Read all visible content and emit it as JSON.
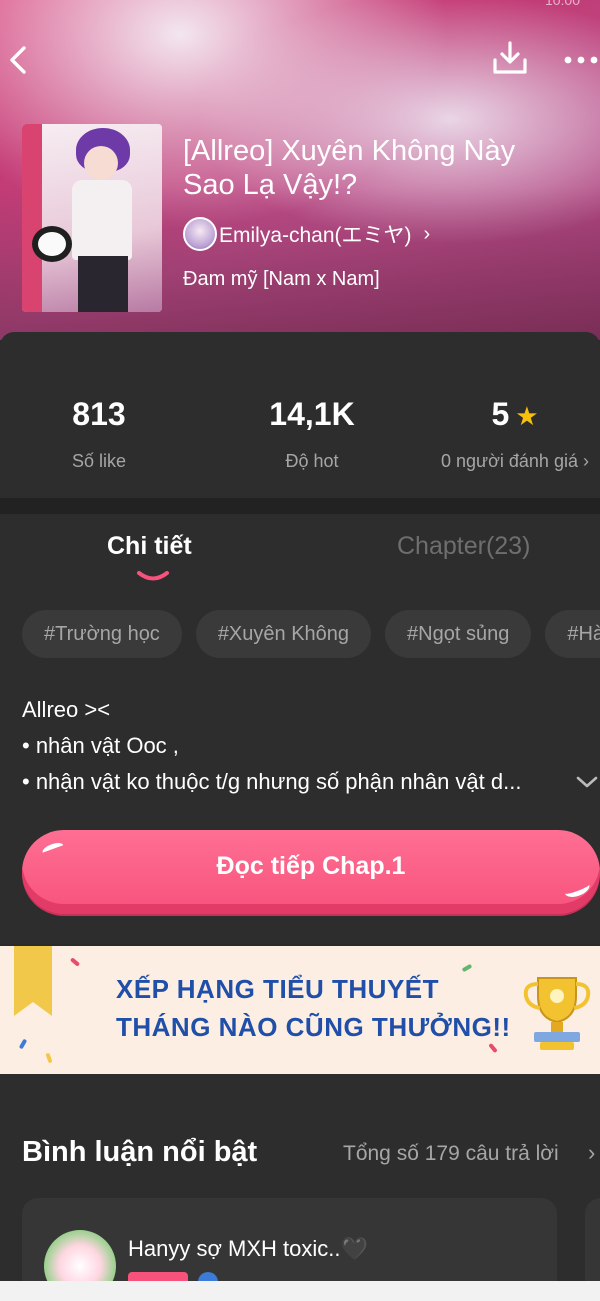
{
  "status": {
    "time": "10:00"
  },
  "header": {
    "title": "[Allreo] Xuyên Không Này Sao Lạ Vậy!?",
    "author": "Emilya-chan(エミヤ)",
    "genre": "Đam mỹ [Nam x Nam]",
    "icons": [
      "back-icon",
      "download-icon",
      "more-icon"
    ]
  },
  "stats": [
    {
      "value": "813",
      "label": "Số like"
    },
    {
      "value": "14,1K",
      "label": "Độ hot"
    },
    {
      "value": "5",
      "label": "0 người đánh giá ›"
    }
  ],
  "tabs": [
    {
      "label": "Chi tiết",
      "active": true
    },
    {
      "label": "Chapter(23)",
      "active": false
    }
  ],
  "tags": [
    "#Trường học",
    "#Xuyên Không",
    "#Ngọt sủng",
    "#Hài hước"
  ],
  "description": [
    "Allreo ><",
    "• nhân vật Ooc ,",
    "• nhận vật ko thuộc t/g nhưng số phận nhân vật d..."
  ],
  "read_button": "Đọc tiếp Chap.1",
  "banner": {
    "line1": "XẾP HẠNG TIỂU THUYẾT",
    "line2": "THÁNG NÀO CŨNG THƯỞNG!!"
  },
  "comments": {
    "title": "Bình luận nổi bật",
    "total": "Tổng số 179 câu trả lời",
    "first_user": "Hanyy sợ MXH toxic..🖤"
  },
  "colors": {
    "accent": "#f7527c",
    "background": "#2d2d2d",
    "banner_text": "#1f4fa8",
    "star": "#f5c10c"
  }
}
